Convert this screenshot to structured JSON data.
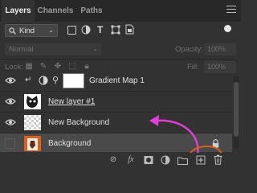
{
  "tabs": [
    {
      "label": "Layers",
      "active": true
    },
    {
      "label": "Channels",
      "active": false
    },
    {
      "label": "Paths",
      "active": false
    }
  ],
  "filter": {
    "kind_label": "Kind"
  },
  "blend": {
    "mode": "Normal",
    "opacity_label": "Opacity:",
    "opacity_value": "100%"
  },
  "lock": {
    "label": "Lock:",
    "fill_label": "Fill:",
    "fill_value": "100%"
  },
  "layers": [
    {
      "name": "Gradient Map 1",
      "visible": true,
      "selected": false,
      "underlined": false
    },
    {
      "name": "New layer #1",
      "visible": true,
      "selected": false,
      "underlined": true
    },
    {
      "name": "New Background",
      "visible": true,
      "selected": false,
      "underlined": false
    },
    {
      "name": "Background",
      "visible": false,
      "selected": true,
      "underlined": false,
      "locked": true
    }
  ],
  "annotation_color": "#e23fd6",
  "accent_orange": "#d9601f",
  "bottom_icons": [
    "link-icon",
    "fx-icon",
    "mask-icon",
    "adjustment-icon",
    "folder-icon",
    "new-layer-icon",
    "trash-icon"
  ]
}
